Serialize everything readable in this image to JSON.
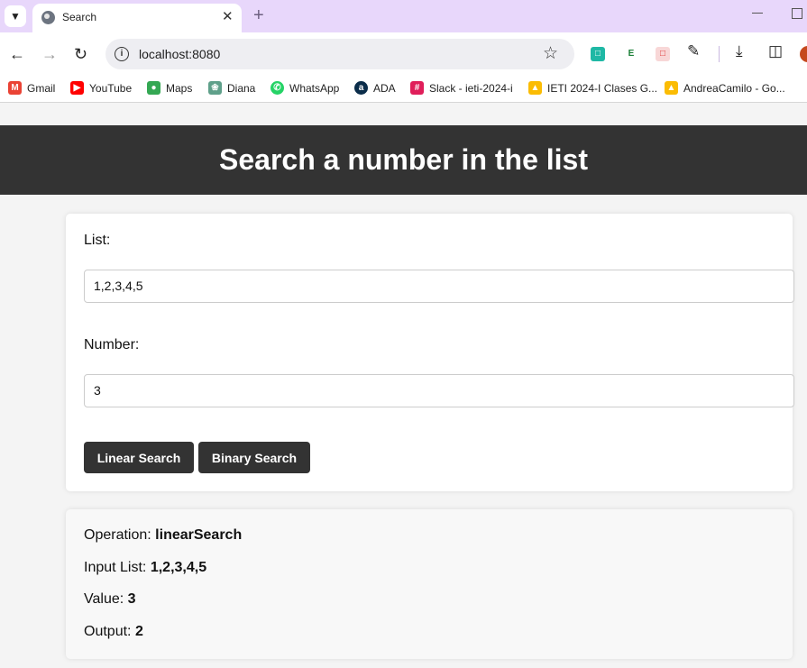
{
  "browser": {
    "tab": {
      "title": "Search",
      "favicon": "globe-icon"
    },
    "url": "localhost:8080",
    "bookmarks": [
      {
        "label": "Gmail",
        "icon": "gmail-icon",
        "color": "#ea4335"
      },
      {
        "label": "YouTube",
        "icon": "youtube-icon",
        "color": "#ff0000"
      },
      {
        "label": "Maps",
        "icon": "maps-icon",
        "color": "#34a853"
      },
      {
        "label": "Diana",
        "icon": "openai-icon",
        "color": "#5fa08a"
      },
      {
        "label": "WhatsApp",
        "icon": "whatsapp-icon",
        "color": "#25d366"
      },
      {
        "label": "ADA",
        "icon": "ada-icon",
        "color": "#0b2d4a"
      },
      {
        "label": "Slack - ieti-2024-i",
        "icon": "slack-icon",
        "color": "#e01e5a"
      },
      {
        "label": "IETI 2024-I Clases G...",
        "icon": "google-drive-icon",
        "color": "#fbbc04"
      },
      {
        "label": "AndreaCamilo - Go...",
        "icon": "google-drive-icon",
        "color": "#fbbc04"
      }
    ]
  },
  "page": {
    "title": "Search a number in the list",
    "form": {
      "list_label": "List:",
      "list_value": "1,2,3,4,5",
      "number_label": "Number:",
      "number_value": "3",
      "linear_button": "Linear Search",
      "binary_button": "Binary Search"
    },
    "result": {
      "operation_label": "Operation:",
      "operation_value": "linearSearch",
      "input_label": "Input List:",
      "input_value": "1,2,3,4,5",
      "value_label": "Value:",
      "value_value": "3",
      "output_label": "Output:",
      "output_value": "2"
    }
  }
}
